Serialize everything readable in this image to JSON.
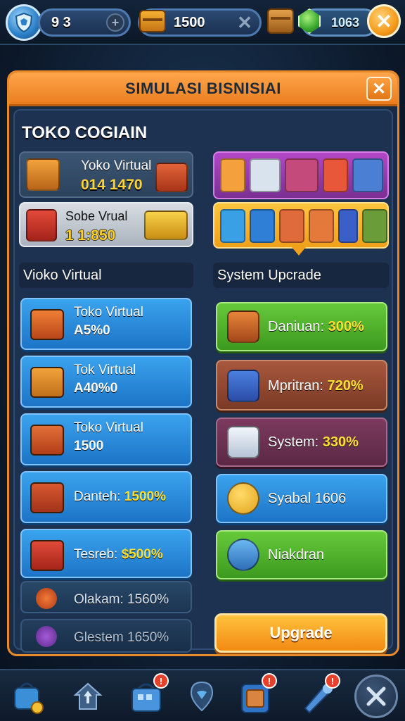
{
  "topbar": {
    "level_value": "9 3",
    "coins_value": "1500",
    "gems_value": "1063",
    "icons": {
      "shield": "shield-icon",
      "plus": "plus-icon",
      "chest": "treasure-chest-icon",
      "close": "close-icon",
      "crate": "crate-icon",
      "gem": "green-gem-icon"
    }
  },
  "panel": {
    "title": "SIMULASI BISNISIAI",
    "subtitle": "TOKO COGIAIN",
    "features": [
      {
        "name": "Yoko Virtual",
        "value": "014 1470"
      },
      {
        "name": "Sobe Vrual",
        "value": "1 1:850"
      }
    ],
    "left_section_label": "Vioko Virtual",
    "right_section_label": "System Upcrade",
    "left_items": [
      {
        "title": "Toko Virtual",
        "value": "A5%0"
      },
      {
        "title": "Tok Virtual",
        "value": "A40%0"
      },
      {
        "title": "Toko Virtual",
        "value": "1500"
      },
      {
        "label": "Danteh: ",
        "value": "1500%"
      },
      {
        "label": "Tesreb: ",
        "value": "$500%"
      },
      {
        "label": "Olakam: 1560%"
      },
      {
        "label": "Glestem 1650%"
      }
    ],
    "right_items": [
      {
        "label": "Daniuan: ",
        "value": "300%"
      },
      {
        "label": "Mpritran: ",
        "value": "720%"
      },
      {
        "label": "System: ",
        "value": "330%"
      },
      {
        "label": "Syabal 1606"
      },
      {
        "label": "Niakdran"
      }
    ],
    "upgrade_label": "Upgrade"
  },
  "bottom_nav": {
    "badges": [
      "!",
      "!",
      "!"
    ],
    "icons": [
      "shop-bag-icon",
      "home-arrow-icon",
      "shopping-basket-icon",
      "map-pin-icon",
      "backpack-icon",
      "rocket-icon",
      "tools-icon"
    ]
  },
  "colors": {
    "accent_orange": "#e97d1f",
    "button_blue": "#1d74c6",
    "button_green": "#3c9a1f",
    "highlight_yellow": "#ffe032"
  }
}
